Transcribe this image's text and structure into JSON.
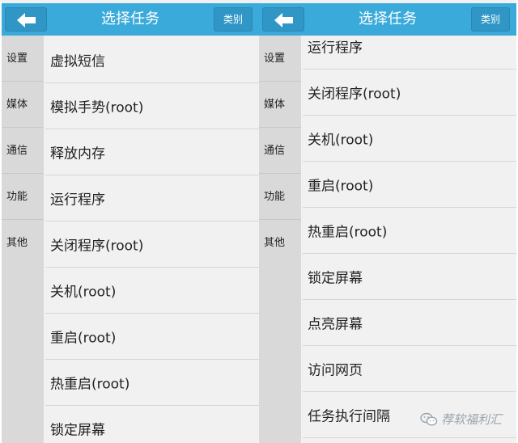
{
  "header": {
    "title": "选择任务",
    "category_label": "类别"
  },
  "sidebar": {
    "items": [
      "设置",
      "媒体",
      "通信",
      "功能",
      "其他"
    ]
  },
  "left_list": {
    "items": [
      "虚拟短信",
      "模拟手势(root)",
      "释放内存",
      "运行程序",
      "关闭程序(root)",
      "关机(root)",
      "重启(root)",
      "热重启(root)",
      "锁定屏幕"
    ]
  },
  "right_list": {
    "items": [
      "运行程序",
      "关闭程序(root)",
      "关机(root)",
      "重启(root)",
      "热重启(root)",
      "锁定屏幕",
      "点亮屏幕",
      "访问网页",
      "任务执行间隔"
    ]
  },
  "watermark": {
    "text": "荐软福利汇"
  },
  "colors": {
    "header": "#3aaadb",
    "button": "#2f96c6",
    "sidebar": "#d9d9d9",
    "list_bg": "#f1f1f1"
  }
}
